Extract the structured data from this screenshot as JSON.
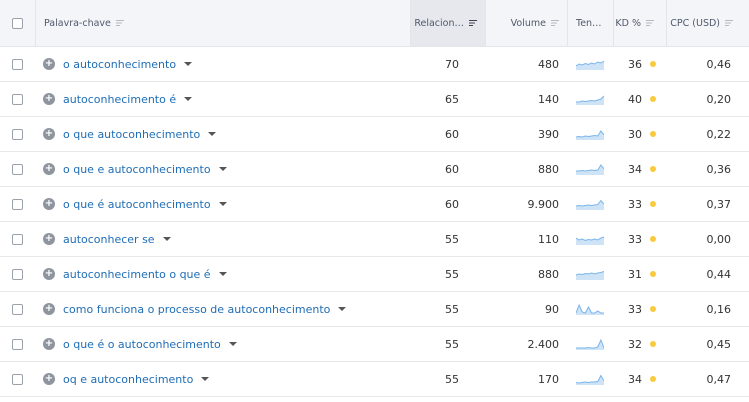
{
  "header": {
    "keyword": "Palavra-chave",
    "relevance": "Relacion…",
    "volume": "Volume",
    "trend": "Ten…",
    "kd": "KD %",
    "cpc": "CPC (USD)"
  },
  "colors": {
    "link": "#1f6db5",
    "kd_dot": "#fbc93d",
    "trend_fill": "#cfe3f7",
    "trend_line": "#79b5ea"
  },
  "rows": [
    {
      "keyword": "o autoconhecimento",
      "relevance": "70",
      "volume": "480",
      "trend": [
        0.3,
        0.5,
        0.4,
        0.55,
        0.45,
        0.6,
        0.5,
        0.7,
        0.6,
        0.8
      ],
      "kd": "36",
      "cpc": "0,46"
    },
    {
      "keyword": "autoconhecimento é",
      "relevance": "65",
      "volume": "140",
      "trend": [
        0.2,
        0.2,
        0.3,
        0.25,
        0.3,
        0.35,
        0.3,
        0.4,
        0.5,
        0.8
      ],
      "kd": "40",
      "cpc": "0,20"
    },
    {
      "keyword": "o que autoconhecimento",
      "relevance": "60",
      "volume": "390",
      "trend": [
        0.2,
        0.25,
        0.2,
        0.3,
        0.25,
        0.3,
        0.35,
        0.3,
        0.8,
        0.4
      ],
      "kd": "30",
      "cpc": "0,22"
    },
    {
      "keyword": "o que e autoconhecimento",
      "relevance": "60",
      "volume": "880",
      "trend": [
        0.3,
        0.3,
        0.35,
        0.3,
        0.35,
        0.4,
        0.35,
        0.4,
        0.9,
        0.5
      ],
      "kd": "34",
      "cpc": "0,36"
    },
    {
      "keyword": "o que é autoconhecimento",
      "relevance": "60",
      "volume": "9.900",
      "trend": [
        0.3,
        0.35,
        0.3,
        0.35,
        0.4,
        0.35,
        0.4,
        0.45,
        0.85,
        0.5
      ],
      "kd": "33",
      "cpc": "0,37"
    },
    {
      "keyword": "autoconhecer se",
      "relevance": "55",
      "volume": "110",
      "trend": [
        0.6,
        0.4,
        0.5,
        0.35,
        0.45,
        0.4,
        0.5,
        0.4,
        0.6,
        0.7
      ],
      "kd": "33",
      "cpc": "0,00"
    },
    {
      "keyword": "autoconhecimento o que é",
      "relevance": "55",
      "volume": "880",
      "trend": [
        0.4,
        0.5,
        0.45,
        0.55,
        0.5,
        0.6,
        0.5,
        0.6,
        0.65,
        0.75
      ],
      "kd": "31",
      "cpc": "0,44"
    },
    {
      "keyword": "como funciona o processo de autoconhecimento",
      "relevance": "55",
      "volume": "90",
      "trend": [
        0.1,
        0.9,
        0.2,
        0.1,
        0.7,
        0.1,
        0.1,
        0.3,
        0.1,
        0.1
      ],
      "kd": "33",
      "cpc": "0,16"
    },
    {
      "keyword": "o que é o autoconhecimento",
      "relevance": "55",
      "volume": "2.400",
      "trend": [
        0.1,
        0.1,
        0.1,
        0.1,
        0.15,
        0.1,
        0.1,
        0.2,
        0.9,
        0.1
      ],
      "kd": "32",
      "cpc": "0,45"
    },
    {
      "keyword": "oq e autoconhecimento",
      "relevance": "55",
      "volume": "170",
      "trend": [
        0.15,
        0.1,
        0.15,
        0.2,
        0.15,
        0.2,
        0.2,
        0.25,
        0.85,
        0.3
      ],
      "kd": "34",
      "cpc": "0,47"
    }
  ]
}
